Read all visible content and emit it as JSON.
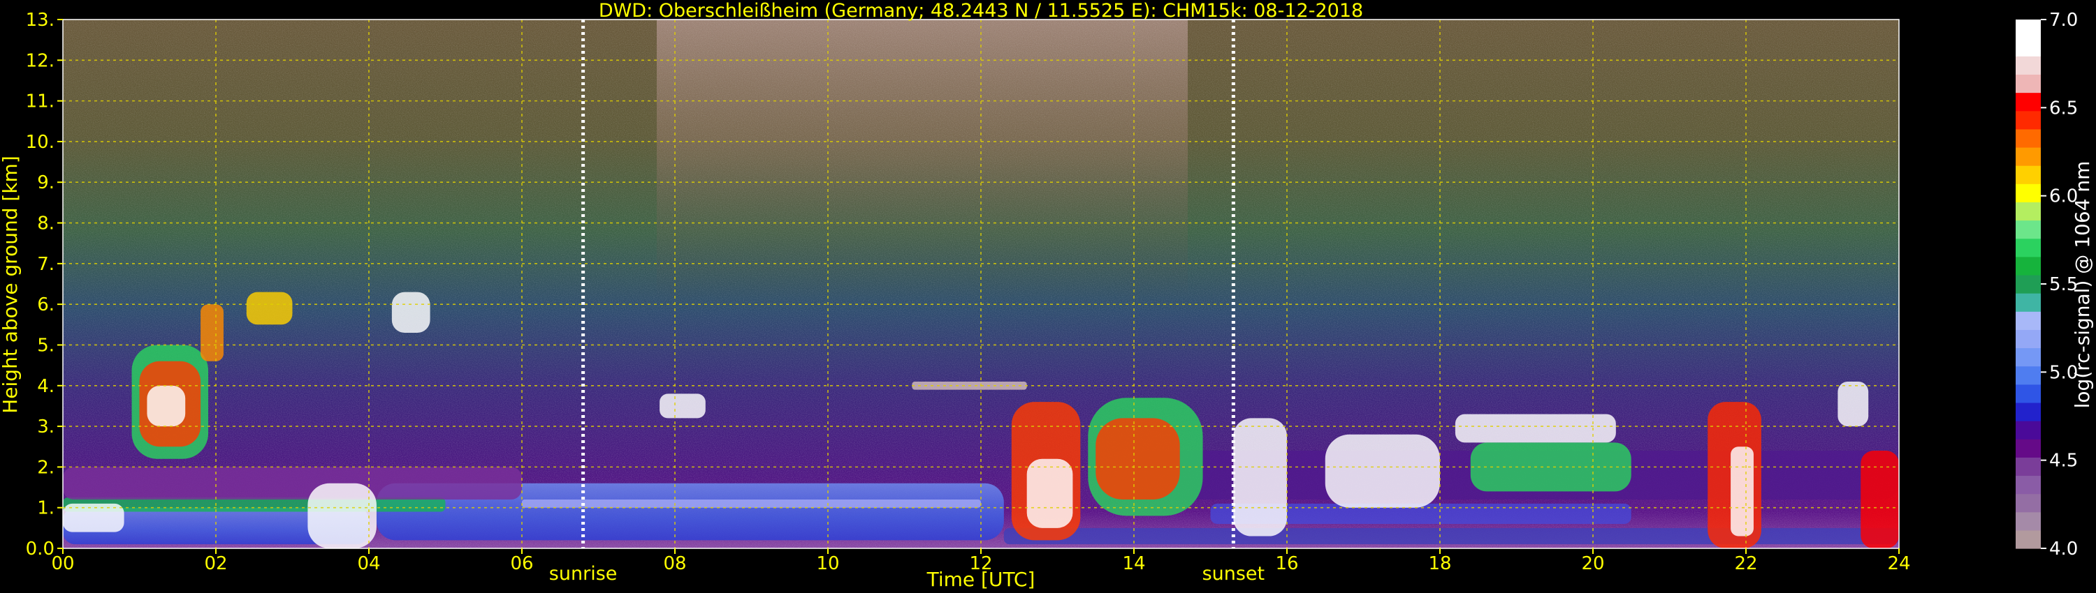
{
  "chart_data": {
    "type": "heatmap",
    "title": "DWD: Oberschleißheim (Germany; 48.2443 N / 11.5525 E):    CHM15k: 08-12-2018",
    "xlabel": "Time [UTC]",
    "ylabel": "Height above ground [km]",
    "xlim": [
      0,
      24
    ],
    "ylim": [
      0,
      13
    ],
    "x_ticks": [
      "00",
      "02",
      "04",
      "06",
      "08",
      "10",
      "12",
      "14",
      "16",
      "18",
      "20",
      "22",
      "24"
    ],
    "y_ticks": [
      "0.0",
      "1.",
      "2.",
      "3.",
      "4.",
      "5.",
      "6.",
      "7.",
      "8.",
      "9.",
      "10.",
      "11.",
      "12.",
      "13."
    ],
    "grid": true,
    "events": [
      {
        "label": "sunrise",
        "time": 6.8
      },
      {
        "label": "sunset",
        "time": 15.3
      }
    ],
    "colorbar": {
      "label": "log(rc-signal) @ 1064 nm",
      "range": [
        4.0,
        7.0
      ],
      "ticks": [
        "4.0",
        "4.5",
        "5.0",
        "5.5",
        "6.0",
        "6.5",
        "7.0"
      ],
      "colors": [
        "#b29a9e",
        "#a58aa8",
        "#946ea4",
        "#8a5ca6",
        "#7a3d99",
        "#650a88",
        "#4a0a99",
        "#2222cc",
        "#2f55e6",
        "#4f7df0",
        "#7598f5",
        "#94a8f6",
        "#a8b8f8",
        "#3fb5a4",
        "#1f9e55",
        "#16b33c",
        "#2bd25f",
        "#6ce68a",
        "#b4ee60",
        "#ffff00",
        "#ffd000",
        "#ff9a00",
        "#ff6a00",
        "#ff2a00",
        "#ff0000",
        "#eeb6b6",
        "#f2d8d8",
        "#ffffff",
        "#ffffff"
      ]
    }
  }
}
